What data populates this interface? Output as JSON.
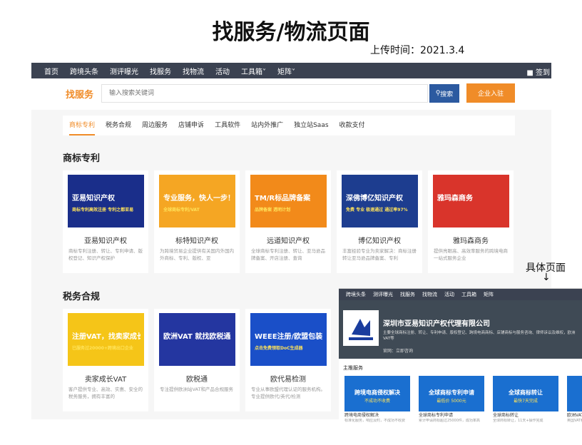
{
  "page_title": "找服务/物流页面",
  "upload_time": "上传时间：2021.3.4",
  "detail_label": "具体页面",
  "detail_arrow": "↓",
  "topnav": {
    "items": [
      "首页",
      "跨境头条",
      "测评曝光",
      "找服务",
      "找物流",
      "活动",
      "工具箱",
      "矩阵"
    ],
    "dropdown_mark": "˅",
    "signin": "签到"
  },
  "search": {
    "brand": "找服务",
    "placeholder": "输入搜索关键词",
    "button": "搜索",
    "join": "企业入驻"
  },
  "categories": [
    "商标专利",
    "税务合规",
    "周边服务",
    "店铺申诉",
    "工具软件",
    "站内外推广",
    "独立站Saas",
    "收款支付"
  ],
  "sections": {
    "trademark": "商标专利",
    "tax": "税务合规"
  },
  "cards": [
    {
      "title": "亚易知识产权",
      "desc": "商标专利注册、转让、专利申请、版权登记、知识产权保护",
      "img": "亚易知识产权",
      "img_sub": "商标专利高效注册 专利之都亚易",
      "bg": "#1a2e8a"
    },
    {
      "title": "标特知识产权",
      "desc": "为跨境贸易企业提供有关国内外国内外商标、专利、版权、亚",
      "img": "专业服务，快人一步！",
      "img_sub": "全球商标专利/VAT",
      "bg": "#f5a623"
    },
    {
      "title": "远道知识产权",
      "desc": "全球商标专利注册、转让、亚马逊品牌备案、开店注册、查询",
      "img": "TM/R标品牌备案",
      "img_sub": "品牌备案 透明计划",
      "bg": "#f28a1a"
    },
    {
      "title": "博亿知识产权",
      "desc": "丰富经验专业为卖家解决：商标注册转让亚马逊品牌备案、专利",
      "img": "深佛博亿知识产权",
      "img_sub": "免费 专业 极速通过 通过率97%",
      "bg": "#1d3d8f"
    },
    {
      "title": "雅玛森商务",
      "desc": "提供亮眼高、高效率服务的跨境电商一站式服务企业",
      "img": "雅玛森商务",
      "img_sub": "",
      "bg": "#d9342b"
    },
    {
      "title": "卖家成长VAT",
      "desc": "客户提供专业、高效、实惠、安全的税务服务，拥有丰富的",
      "img": "注册VAT，找卖家成长",
      "img_sub": "已服务过20000+跨境出口企业",
      "bg": "#f5c518"
    },
    {
      "title": "欧税通",
      "desc": "专注提供欧洲站VAT和产品合规服务",
      "img": "欧洲VAT 就找欧税通",
      "img_sub": "",
      "bg": "#2436a0"
    },
    {
      "title": "欧代易检测",
      "desc": "专业从事欧盟代理认证的服务机构。专业提供欧代/英代/检测",
      "img": "WEEE注册/欧盟包装",
      "img_sub": "点击免费领取DoC生成器",
      "bg": "#1a4fc8"
    }
  ],
  "detail": {
    "nav": [
      "跨境头条",
      "测评曝光",
      "找服务",
      "找物流",
      "活动",
      "工具箱",
      "矩阵"
    ],
    "company": "深圳市亚易知识产权代理有限公司",
    "intro": "主要全球商标注册、转让、专利申请、版权登记、跨境电商商标、店铺商标与服务咨询、律师诉讼及维权，欧洲VAT等",
    "link": "官网：立即咨询",
    "section": "主推服务",
    "services": [
      {
        "img": "跨境电商侵权解决",
        "sub": "不成功不收费",
        "title": "跨境电商侵权解决",
        "desc": "标准化服务，响应及时，不成功不收费"
      },
      {
        "img": "全球商标专利申请",
        "sub": "最低价 5000元",
        "title": "全球商标专利申请",
        "desc": "累计申请商标超过25000件，成功率高"
      },
      {
        "img": "全球商标转让",
        "sub": "最快7天完成",
        "title": "全球商标转让",
        "desc": "全球商标转让，11天+操作完成"
      },
      {
        "img": "欧洲VAT",
        "sub": "",
        "title": "欧洲VAT申",
        "desc": "英国VAT税号"
      }
    ]
  },
  "colors": {
    "accent": "#f08c28",
    "nav": "#3b4251",
    "search_btn": "#2c5aa0"
  }
}
